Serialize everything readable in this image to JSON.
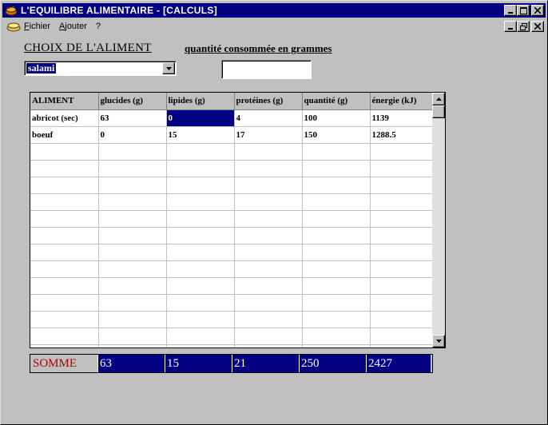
{
  "window": {
    "title": "L'EQUILIBRE ALIMENTAIRE - [CALCULS]",
    "controls": {
      "minimize": "_",
      "maximize": "□",
      "close": "✕",
      "restore": "❐"
    }
  },
  "menu": {
    "items": [
      {
        "underline": "F",
        "rest": "ichier"
      },
      {
        "underline": "A",
        "rest": "jouter"
      },
      {
        "underline": "",
        "rest": "?"
      }
    ]
  },
  "form": {
    "choix_label": "CHOIX DE L'ALIMENT",
    "selected_food": "salami",
    "quantite_label": "quantité consommée en grammes",
    "quantite_value": ""
  },
  "table": {
    "columns": [
      "ALIMENT",
      "glucides (g)",
      "lipides (g)",
      "protéines (g)",
      "quantité (g)",
      "énergie (kJ)"
    ],
    "rows": [
      [
        "abricot (sec)",
        "63",
        "0",
        "4",
        "100",
        "1139"
      ],
      [
        "boeuf",
        "0",
        "15",
        "17",
        "150",
        "1288.5"
      ]
    ],
    "empty_rows": 13,
    "selected_cell": {
      "row": 0,
      "col": 2
    }
  },
  "somme": {
    "label": "SOMME",
    "values": [
      "63",
      "15",
      "21",
      "250",
      "2427"
    ]
  },
  "colors": {
    "titlebar": "#000080",
    "selection": "#000080",
    "somme_label": "#b00000",
    "face": "#c0c0c0"
  }
}
